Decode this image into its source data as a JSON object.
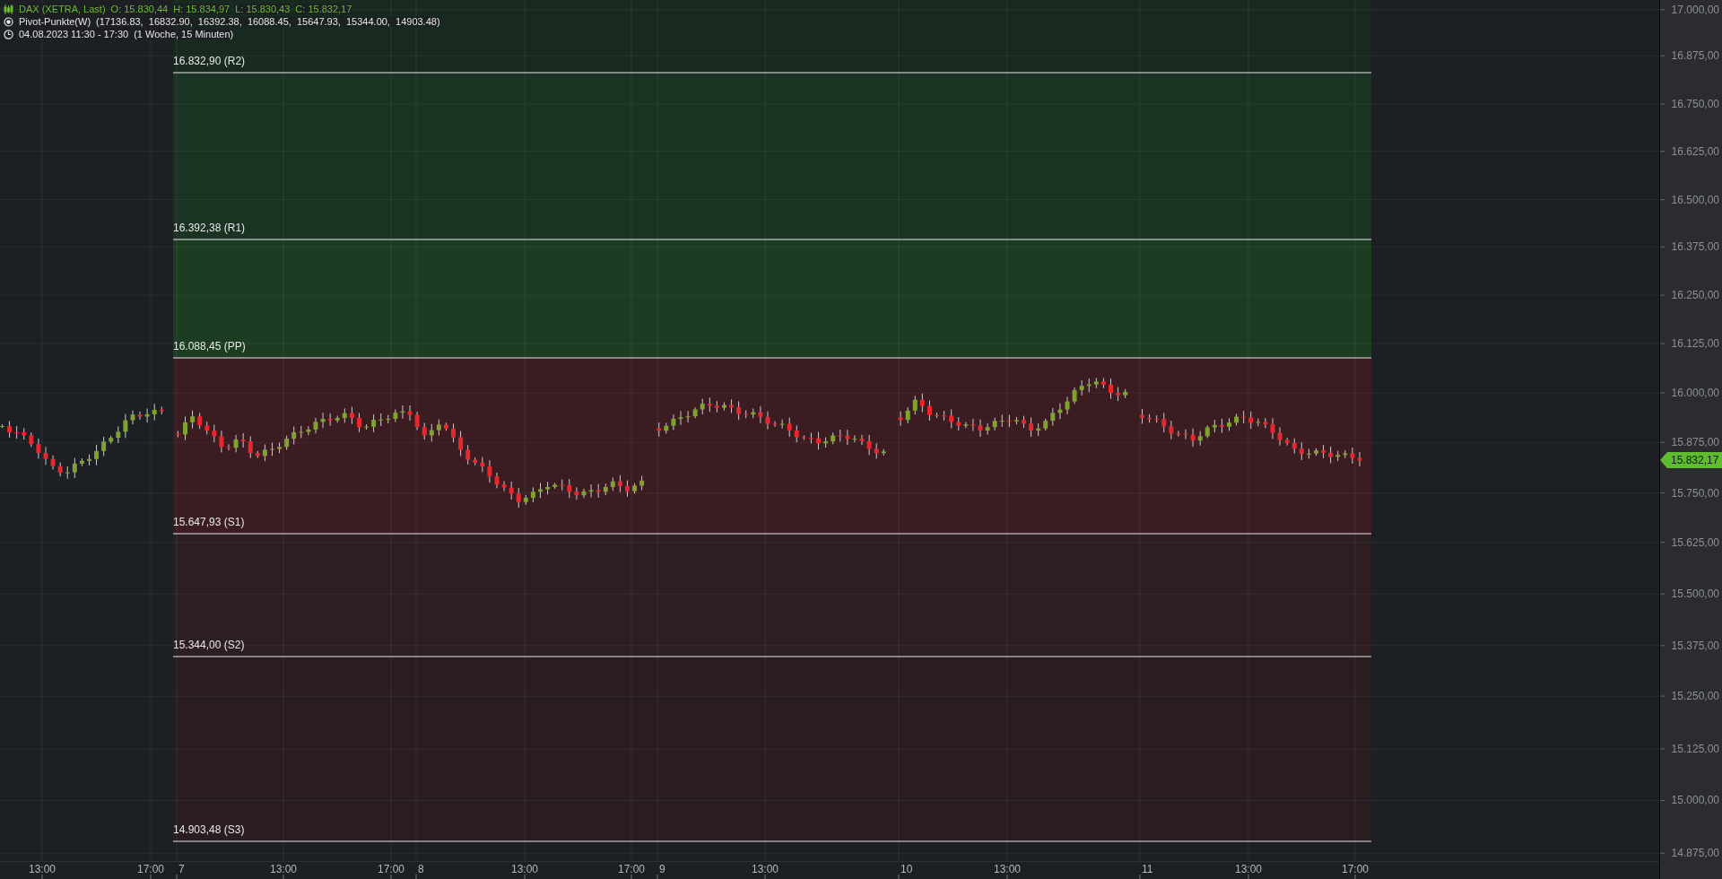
{
  "legend": {
    "instrument": "DAX (XETRA, Last)",
    "ohlc": [
      "O: 15.830,44",
      "H: 15.834,97",
      "L: 15.830,43",
      "C: 15.832,17"
    ],
    "indicator": "Pivot-Punkte(W)",
    "indicator_values": "(17136.83,  16832.90,  16392.38,  16088.45,  15647.93,  15344.00,  14903.48)",
    "period": "04.08.2023 11:30 - 17:30",
    "range": "(1 Woche, 15 Minuten)"
  },
  "pivots": [
    {
      "label": "16.832,90 (R2)"
    },
    {
      "label": "16.392,38 (R1)"
    },
    {
      "label": "16.088,45 (PP)"
    },
    {
      "label": "15.647,93 (S1)"
    },
    {
      "label": "15.344,00 (S2)"
    },
    {
      "label": "14.903,48 (S3)"
    }
  ],
  "price_axis": {
    "ticks": [
      "17.000,00",
      "16.875,00",
      "16.750,00",
      "16.625,00",
      "16.500,00",
      "16.375,00",
      "16.250,00",
      "16.125,00",
      "16.000,00",
      "15.875,00",
      "15.750,00",
      "15.625,00",
      "15.500,00",
      "15.375,00",
      "15.250,00",
      "15.125,00",
      "15.000,00",
      "14.875,00"
    ],
    "current_price": "15.832,17"
  },
  "time_axis": {
    "ticks": [
      "13:00",
      "17:00",
      "7",
      "13:00",
      "17:00",
      "8",
      "13:00",
      "17:00",
      "9",
      "13:00",
      "10",
      "13:00",
      "11",
      "13:00",
      "17:00"
    ]
  }
}
